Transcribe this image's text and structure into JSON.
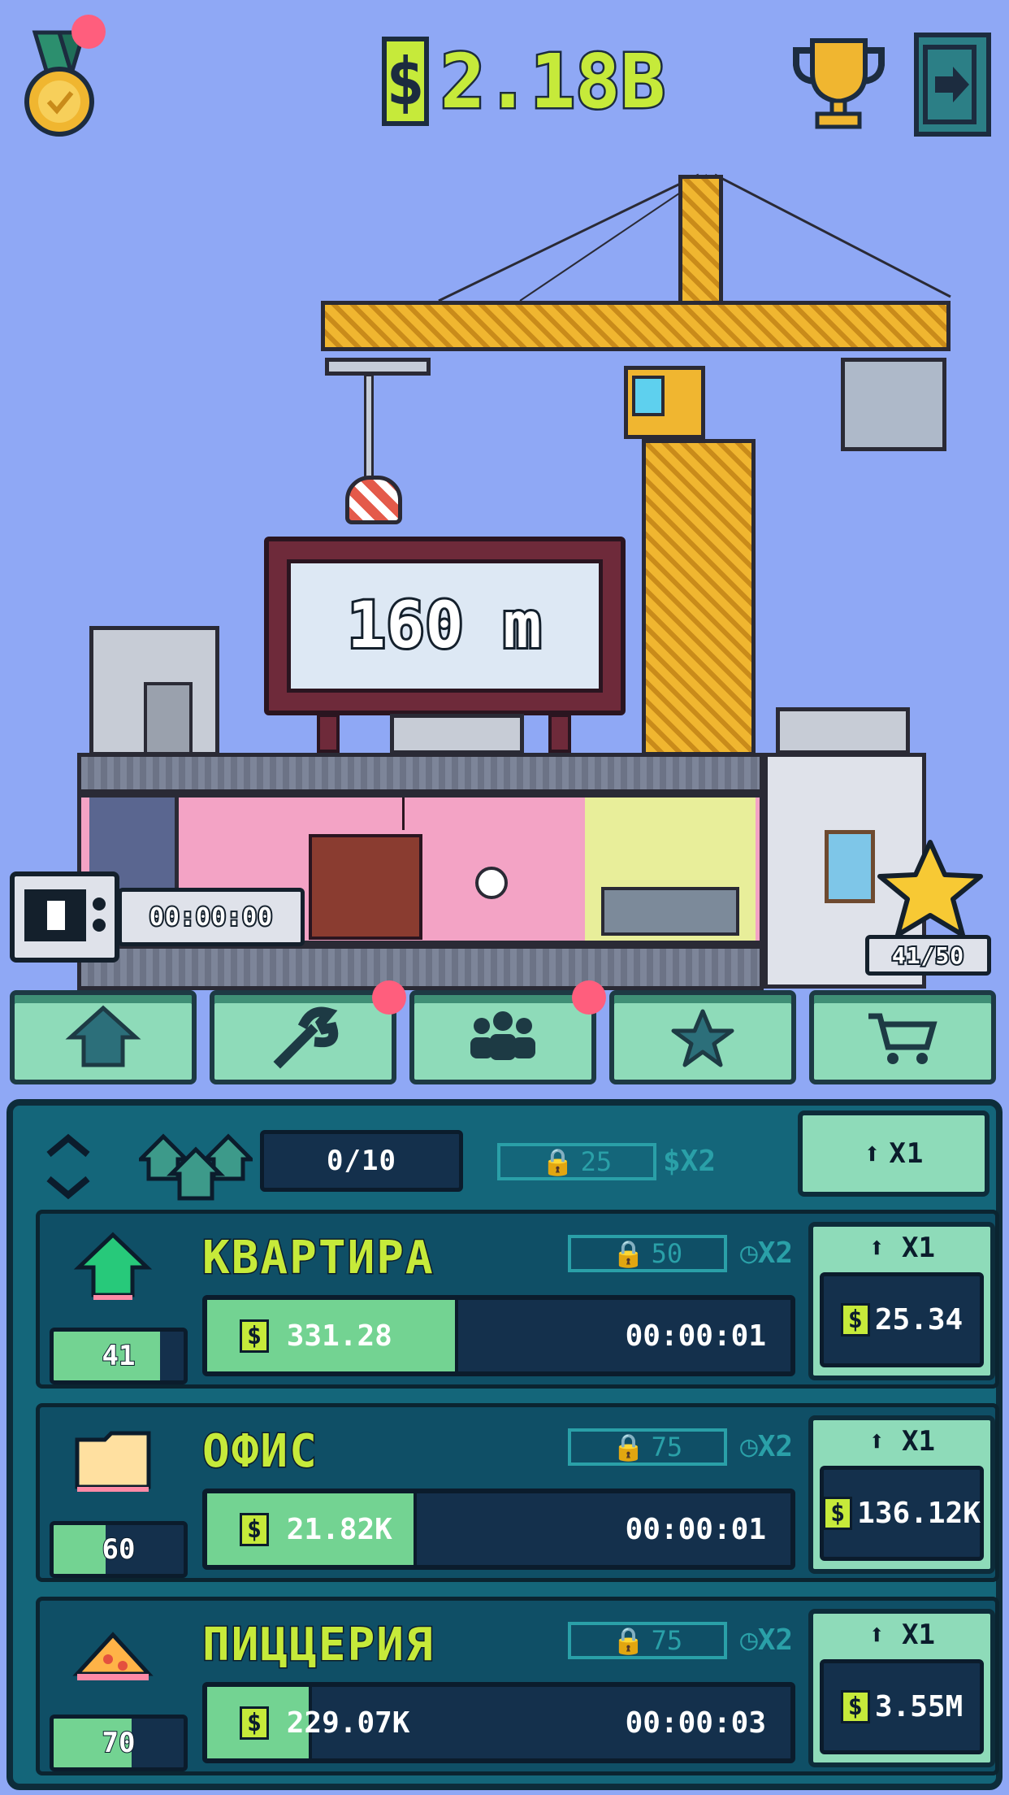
{
  "top": {
    "currency_symbol": "$",
    "money": "2.18B",
    "icons": [
      "medal-icon",
      "trophy-icon",
      "exit-icon"
    ]
  },
  "building": {
    "height_sign": "160 m",
    "tv_timer": "00:00:00",
    "star_count": "41/50"
  },
  "tabs": [
    {
      "icon": "house-icon",
      "badge": false
    },
    {
      "icon": "wrench-icon",
      "badge": true
    },
    {
      "icon": "people-icon",
      "badge": true
    },
    {
      "icon": "star-icon",
      "badge": false
    },
    {
      "icon": "cart-icon",
      "badge": false
    }
  ],
  "panel_header": {
    "count": "0/10",
    "lock_value": "25",
    "multiplier": "$X2",
    "buy_label": "X1"
  },
  "businesses": [
    {
      "name": "КВАРТИРА",
      "level": "41",
      "level_progress": 0.82,
      "lock_value": "50",
      "multiplier": "X2",
      "income": "331.28",
      "progress": 0.43,
      "timer": "00:00:01",
      "buy_label": "X1",
      "price": "25.34",
      "icon": "house-icon"
    },
    {
      "name": "ОФИС",
      "level": "60",
      "level_progress": 0.4,
      "lock_value": "75",
      "multiplier": "X2",
      "income": "21.82K",
      "progress": 0.36,
      "timer": "00:00:01",
      "buy_label": "X1",
      "price": "136.12K",
      "icon": "folder-icon"
    },
    {
      "name": "ПИЦЦЕРИЯ",
      "level": "70",
      "level_progress": 0.6,
      "lock_value": "75",
      "multiplier": "X2",
      "income": "229.07K",
      "progress": 0.18,
      "timer": "00:00:03",
      "buy_label": "X1",
      "price": "3.55M",
      "icon": "pizza-icon"
    }
  ],
  "colors": {
    "sky": "#8fa8f5",
    "money": "#c6ea3a",
    "panel": "#14667a",
    "button": "#8edbb9",
    "badge": "#ff5e7d"
  }
}
